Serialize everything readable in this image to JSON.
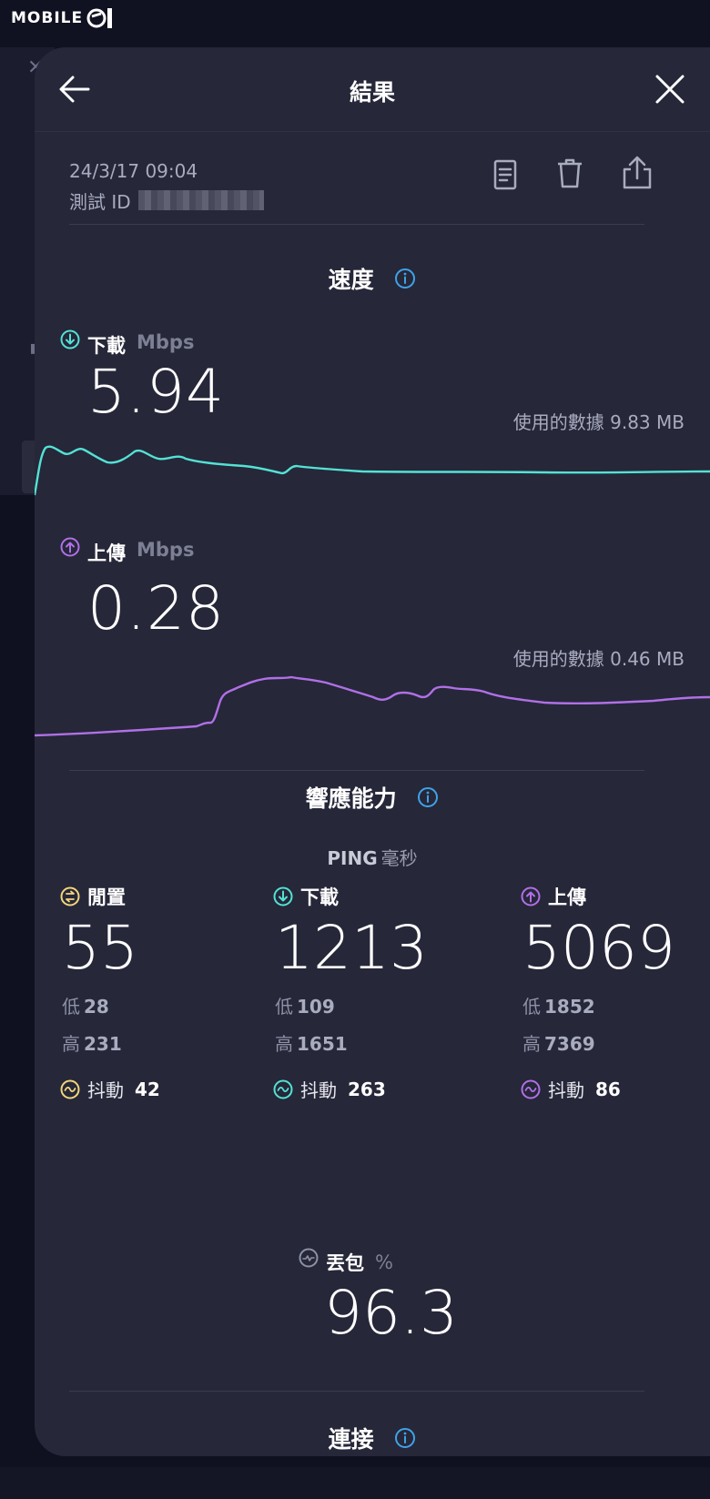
{
  "watermark": {
    "brand": "MOBILE01"
  },
  "header": {
    "title": "結果",
    "back_icon": "arrow-left-icon",
    "close_icon": "close-icon"
  },
  "result_meta": {
    "datetime": "24/3/17 09:04",
    "test_id_label": "測試 ID",
    "actions": [
      "document-icon",
      "trash-icon",
      "share-icon"
    ]
  },
  "speed": {
    "title": "速度",
    "download": {
      "label": "下載",
      "unit": "Mbps",
      "value": "5.94",
      "data_used": "使用的數據 9.83 MB",
      "color": "#53e2d5"
    },
    "upload": {
      "label": "上傳",
      "unit": "Mbps",
      "value": "0.28",
      "data_used": "使用的數據 0.46 MB",
      "color": "#b070e6"
    }
  },
  "responsiveness": {
    "title": "響應能力",
    "ping_label": "PING",
    "ping_unit": "毫秒",
    "idle": {
      "label": "閒置",
      "value": "55",
      "low_label": "低",
      "low": "28",
      "high_label": "高",
      "high": "231",
      "jitter_label": "抖動",
      "jitter": "42",
      "color": "#f3d57a"
    },
    "download": {
      "label": "下載",
      "value": "1213",
      "low_label": "低",
      "low": "109",
      "high_label": "高",
      "high": "1651",
      "jitter_label": "抖動",
      "jitter": "263",
      "color": "#53e2d5"
    },
    "upload": {
      "label": "上傳",
      "value": "5069",
      "low_label": "低",
      "low": "1852",
      "high_label": "高",
      "high": "7369",
      "jitter_label": "抖動",
      "jitter": "86",
      "color": "#b070e6"
    },
    "packet_loss": {
      "label": "丟包",
      "unit": "%",
      "value": "96.3"
    }
  },
  "connection": {
    "title": "連接"
  }
}
